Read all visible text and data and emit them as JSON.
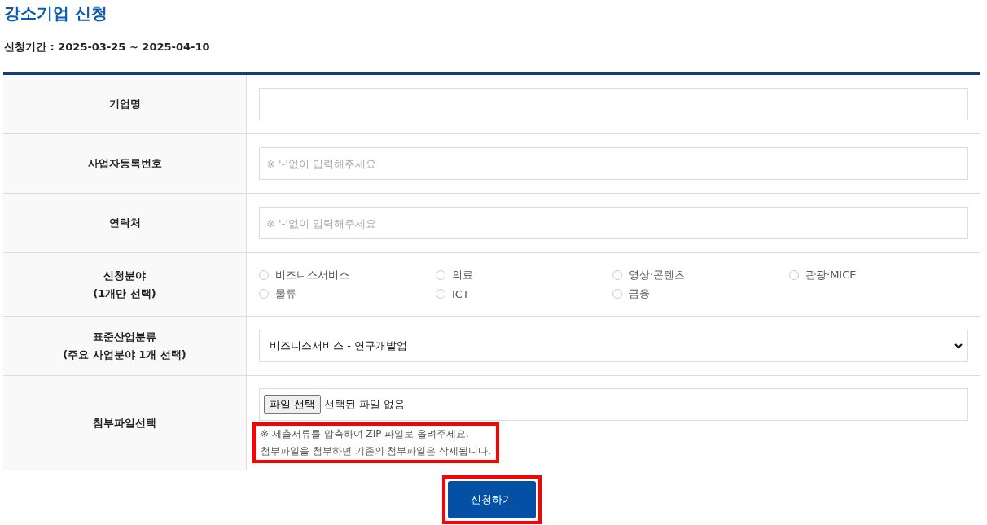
{
  "title": "강소기업 신청",
  "period": "신청기간 : 2025-03-25 ~ 2025-04-10",
  "fields": [
    {
      "kind": "text",
      "label": "기업명"
    },
    {
      "kind": "text",
      "label": "사업자등록번호",
      "placeholder": "※ '-'없이 입력해주세요"
    },
    {
      "kind": "text",
      "label": "연락처",
      "placeholder": "※ '-'없이 입력해주세요"
    },
    {
      "kind": "radio",
      "label": "신청분야",
      "sublabel": "(1개만 선택)",
      "options": [
        {
          "label": "비즈니스서비스",
          "selected": false
        },
        {
          "label": "의료",
          "selected": false
        },
        {
          "label": "영상·콘텐츠",
          "selected": false
        },
        {
          "label": "관광·MICE",
          "selected": false
        },
        {
          "label": "물류",
          "selected": false
        },
        {
          "label": "ICT",
          "selected": false
        },
        {
          "label": "금융",
          "selected": false
        }
      ]
    },
    {
      "kind": "select",
      "label": "표준산업분류",
      "sublabel": "(주요 사업분야 1개 선택)",
      "value": "비즈니스서비스 - 연구개발업"
    },
    {
      "kind": "file",
      "label": "첨부파일선택",
      "button": "파일 선택",
      "status": "선택된 파일 없음",
      "notes": [
        "※ 제출서류를 압축하여 ZIP 파일로 올려주세요.",
        "첨부파일을 첨부하면 기존의 첨부파일은 삭제됩니다."
      ],
      "notes_highlighted": true
    }
  ],
  "submit": {
    "label": "신청하기",
    "highlighted": true
  }
}
